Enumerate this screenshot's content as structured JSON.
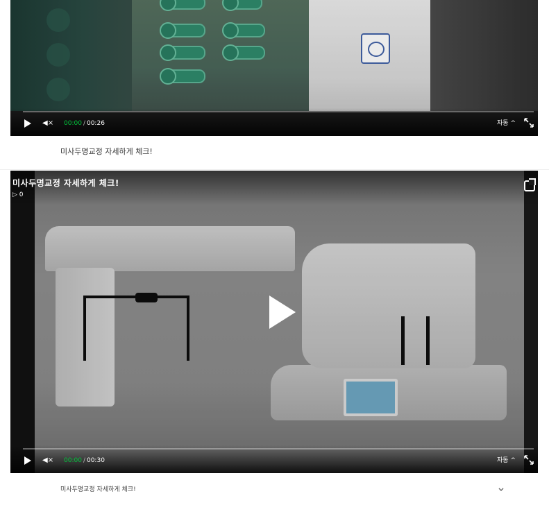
{
  "videos": [
    {
      "current_time": "00:00",
      "duration": "00:26",
      "quality": "자동",
      "quality_arrow": "^",
      "caption": "미사두명교정 자세하게 체크!",
      "progress": 0
    },
    {
      "title": "미사두명교정 자세하게 체크!",
      "views_prefix": "▷ 0",
      "current_time": "00:00",
      "duration": "00:30",
      "quality": "자동",
      "quality_arrow": "^",
      "caption": "미사두명교정 자세하게 체크!",
      "progress": 0
    }
  ],
  "time_separator": "/",
  "mute_glyph": "◀×",
  "icons": {
    "play": "play-icon",
    "mute": "mute-icon",
    "fullscreen": "fullscreen-icon",
    "share": "share-icon",
    "expand": "chevron-down-icon"
  },
  "colors": {
    "accent_green": "#00c73c",
    "player_bg": "#1c1c1c"
  }
}
